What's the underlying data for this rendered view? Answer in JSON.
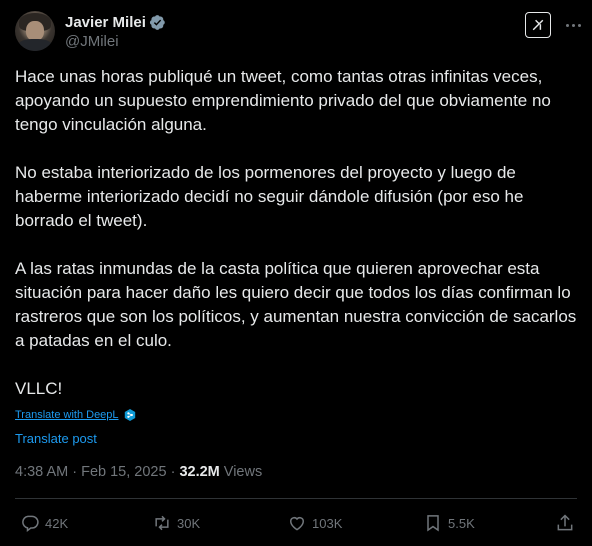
{
  "author": {
    "name": "Javier Milei",
    "handle": "@JMilei"
  },
  "icons": {
    "verified": "verified-badge-icon",
    "grok": "grok-icon",
    "more": "more-icon",
    "deepl": "deepl-icon",
    "reply": "reply-icon",
    "retweet": "retweet-icon",
    "like": "like-icon",
    "bookmark": "bookmark-icon",
    "share": "share-icon"
  },
  "tweet": {
    "paragraphs": [
      "Hace unas horas publiqué un tweet, como tantas otras infinitas veces, apoyando un supuesto emprendimiento privado del que obviamente no tengo vinculación alguna.",
      "No estaba interiorizado de los pormenores del proyecto y luego de haberme interiorizado decidí no seguir dándole difusión (por eso he borrado el tweet).",
      "A las ratas inmundas de la casta política que quieren aprovechar esta situación para hacer daño les quiero decir que todos los días confirman lo rastreros que son los políticos, y aumentan nuestra convicción de sacarlos a patadas en el culo.",
      "VLLC!"
    ],
    "translate_deepl": "Translate with DeepL",
    "translate_post": "Translate post",
    "time": "4:38 AM",
    "date": "Feb 15, 2025",
    "views_count": "32.2M",
    "views_label": "Views"
  },
  "actions": {
    "replies": "42K",
    "retweets": "30K",
    "likes": "103K",
    "bookmarks": "5.5K"
  },
  "colors": {
    "background": "#000000",
    "text": "#e7e9ea",
    "secondary": "#71767b",
    "link": "#1d9bf0",
    "divider": "#2f3336"
  }
}
